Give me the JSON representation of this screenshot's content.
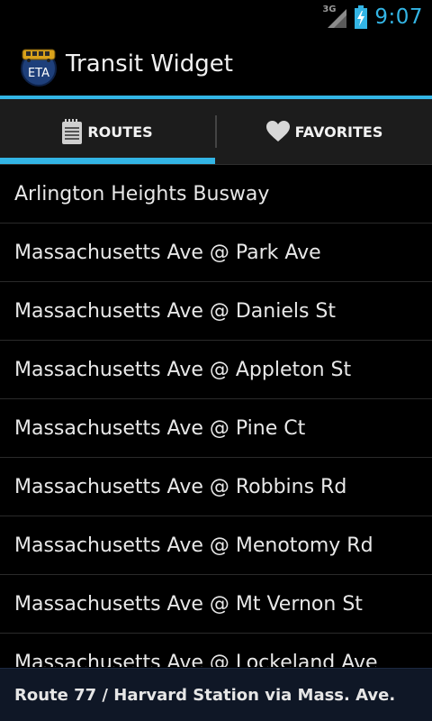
{
  "status_bar": {
    "network_label": "3G",
    "time": "9:07",
    "icons": [
      "signal-icon",
      "battery-charging-icon"
    ]
  },
  "action_bar": {
    "icon_name": "eta-bus-logo-icon",
    "icon_text": "ETA",
    "title": "Transit Widget",
    "accent_color": "#33b5e5"
  },
  "tabs": [
    {
      "label": "ROUTES",
      "icon": "notepad-icon",
      "selected": true
    },
    {
      "label": "FAVORITES",
      "icon": "heart-icon",
      "selected": false
    }
  ],
  "stops": [
    "Arlington Heights Busway",
    "Massachusetts Ave @ Park Ave",
    "Massachusetts Ave @ Daniels St",
    "Massachusetts Ave @ Appleton St",
    "Massachusetts Ave @ Pine Ct",
    "Massachusetts Ave @ Robbins Rd",
    "Massachusetts Ave @ Menotomy Rd",
    "Massachusetts Ave @ Mt Vernon St",
    "Massachusetts Ave @ Lockeland Ave"
  ],
  "footer": {
    "route_label": "Route 77 / Harvard Station via Mass. Ave."
  }
}
